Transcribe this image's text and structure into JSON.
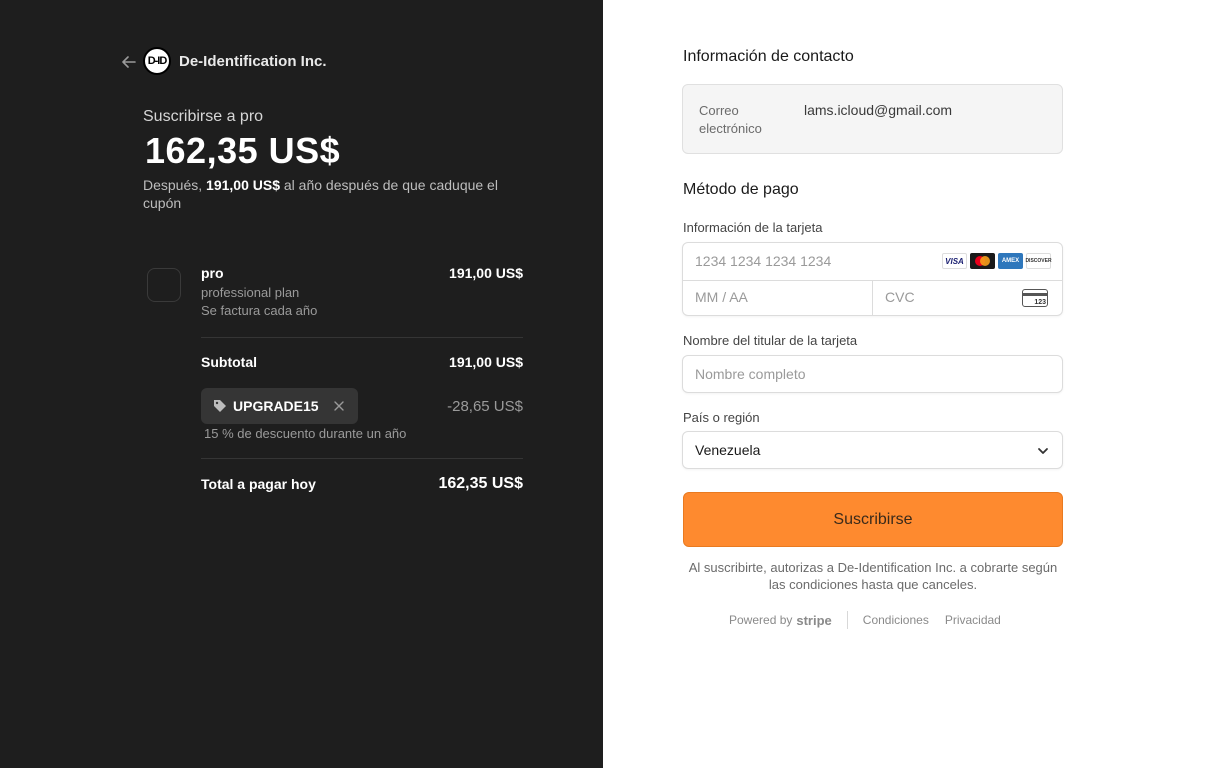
{
  "header": {
    "company": "De-Identification Inc.",
    "logo_text": "D-ID"
  },
  "summary": {
    "subscribe_title": "Suscribirse a pro",
    "price": "162,35 US$",
    "after_prefix": "Después, ",
    "after_amount": "191,00 US$",
    "after_suffix": " al año después de que caduque el cupón"
  },
  "line_item": {
    "name": "pro",
    "description": "professional plan",
    "billing": "Se factura cada año",
    "price": "191,00 US$"
  },
  "subtotal": {
    "label": "Subtotal",
    "value": "191,00 US$"
  },
  "coupon": {
    "code": "UPGRADE15",
    "discount": "-28,65 US$",
    "description": "15 % de descuento durante un año"
  },
  "total": {
    "label": "Total a pagar hoy",
    "value": "162,35 US$"
  },
  "contact": {
    "section_title": "Información de contacto",
    "email_label": "Correo electrónico",
    "email_value": "lams.icloud@gmail.com"
  },
  "payment": {
    "section_title": "Método de pago",
    "card_label": "Información de la tarjeta",
    "card_number_placeholder": "1234 1234 1234 1234",
    "expiry_placeholder": "MM / AA",
    "cvc_placeholder": "CVC",
    "cvc_icon_number": "123",
    "brands": {
      "visa": "VISA",
      "amex": "AMEX",
      "discover": "DISCOVER"
    },
    "cardholder_label": "Nombre del titular de la tarjeta",
    "cardholder_placeholder": "Nombre completo",
    "country_label": "País o región",
    "country_value": "Venezuela"
  },
  "actions": {
    "subscribe_label": "Suscribirse"
  },
  "legal": {
    "text": "Al suscribirte, autorizas a De-Identification Inc. a cobrarte según las condiciones hasta que canceles."
  },
  "footer": {
    "powered_by": "Powered by",
    "stripe": "stripe",
    "terms": "Condiciones",
    "privacy": "Privacidad"
  },
  "colors": {
    "left_bg": "#1e1e1e",
    "accent": "#fe8a2f"
  }
}
